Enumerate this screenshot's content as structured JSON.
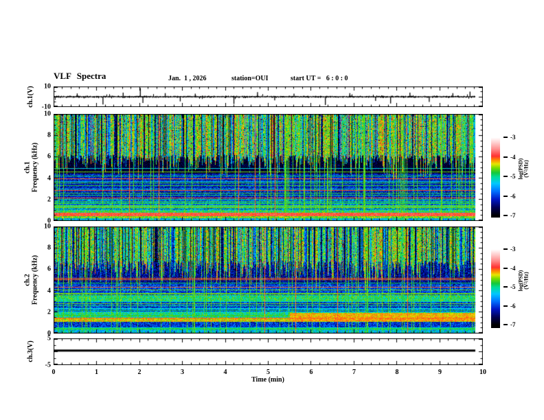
{
  "figure": {
    "background": "#ffffff"
  },
  "header": {
    "title": "VLF Spectra",
    "date_label": "Jan.  1 , 2026",
    "station_label": "station=OUI",
    "start_ut_label": "start UT =   6 : 0 : 0"
  },
  "time_axis": {
    "label": "Time (min)",
    "min": 0,
    "max": 10,
    "major_ticks": [
      0,
      1,
      2,
      3,
      4,
      5,
      6,
      7,
      8,
      9,
      10
    ],
    "minor_interval": 0.2
  },
  "colorbar": {
    "label": "log(PSD)(V²/Hz)",
    "ticks": [
      -3,
      -4,
      -5,
      -6,
      -7
    ],
    "value_range": [
      -7,
      -3
    ],
    "palette_stops": [
      [
        -7,
        "#000000"
      ],
      [
        -6.6,
        "#000050"
      ],
      [
        -6.15,
        "#0018c8"
      ],
      [
        -5.75,
        "#0070ff"
      ],
      [
        -5.35,
        "#00c8ff"
      ],
      [
        -5,
        "#00dc96"
      ],
      [
        -4.8,
        "#14c83c"
      ],
      [
        -4.55,
        "#78dc00"
      ],
      [
        -4.35,
        "#e6e600"
      ],
      [
        -4.15,
        "#ff8c00"
      ],
      [
        -3.95,
        "#ff3232"
      ],
      [
        -3.6,
        "#ff8c8c"
      ],
      [
        -3.3,
        "#ffc8c8"
      ],
      [
        -3,
        "#ffffff"
      ]
    ]
  },
  "chart_data": [
    {
      "type": "line",
      "name": "ch1_waveform",
      "ylabel": "ch.1(V)",
      "ylim": [
        -10,
        10
      ],
      "ytick_labels": [
        10,
        -10
      ],
      "xlim": [
        0,
        10
      ],
      "x_data_end": 9.83,
      "baseline": 0,
      "noise_amplitude": 0.9,
      "seed": 3,
      "spikes": [
        {
          "x": 0.55,
          "v": 3.2
        },
        {
          "x": 1.15,
          "v": -7.5
        },
        {
          "x": 1.62,
          "v": 4
        },
        {
          "x": 2.02,
          "v": 8.5
        },
        {
          "x": 2.08,
          "v": -6
        },
        {
          "x": 2.6,
          "v": 3.5
        },
        {
          "x": 2.95,
          "v": -4.5
        },
        {
          "x": 3.3,
          "v": 3
        },
        {
          "x": 4.2,
          "v": -7
        },
        {
          "x": 4.75,
          "v": 4.5
        },
        {
          "x": 5.15,
          "v": -3.5
        },
        {
          "x": 5.6,
          "v": 3
        },
        {
          "x": 6.33,
          "v": -8
        },
        {
          "x": 6.9,
          "v": 3.5
        },
        {
          "x": 7.5,
          "v": -4
        },
        {
          "x": 7.85,
          "v": -6.5
        },
        {
          "x": 8.3,
          "v": 4
        },
        {
          "x": 8.75,
          "v": -5
        },
        {
          "x": 9.3,
          "v": 3.5
        },
        {
          "x": 9.7,
          "v": 5
        }
      ],
      "description": "Noisy channel-1 voltage trace centered near 0 V with sporadic impulsive spikes up to ±9 V"
    },
    {
      "type": "heatmap",
      "name": "ch1_spectrogram",
      "ylabel": "ch.1\nFrequency (kHz)",
      "ylim": [
        0,
        10
      ],
      "yticks": [
        10,
        8,
        6,
        4,
        2,
        0
      ],
      "xlim": [
        0,
        10
      ],
      "x_data_end": 9.83,
      "value_range": [
        -7,
        -3
      ],
      "seed": 7,
      "bands": [
        {
          "f": [
            6.2,
            10
          ],
          "base": -4.55,
          "speckle": 0.5
        },
        {
          "f": [
            4.4,
            6.2
          ],
          "base": -6.75,
          "speckle": 0.3
        },
        {
          "f": [
            2,
            4.4
          ],
          "base": -6.15,
          "speckle": 0.45
        },
        {
          "f": [
            1,
            2
          ],
          "base": -5.8,
          "speckle": 0.5
        },
        {
          "f": [
            0.75,
            1
          ],
          "base": -5,
          "speckle": 0.6
        },
        {
          "f": [
            0.45,
            0.75
          ],
          "base": -3.9,
          "speckle": 0.25
        },
        {
          "f": [
            0.25,
            0.45
          ],
          "base": -4.6,
          "speckle": 0.4
        },
        {
          "f": [
            0,
            0.25
          ],
          "base": -5.4,
          "speckle": 0.5
        }
      ],
      "streak": {
        "f0": 6.2,
        "max_depth": 2.6
      },
      "vertical_lines": {
        "count": 70,
        "value": -4.7,
        "red_count": 5,
        "red_value": -4.05
      },
      "horizontal_lines": {
        "count": 30,
        "f_range": [
          0.5,
          5
        ],
        "values": [
          -4.9,
          -4.6,
          -4.05,
          -5.2,
          -4.75
        ]
      },
      "patches": [],
      "description": "Strong green emission above ~6 kHz with vertical sferic streaks, dark band 4.5-6 kHz, blue speckle below, intense red band near 0.45-0.75 kHz"
    },
    {
      "type": "heatmap",
      "name": "ch2_spectrogram",
      "ylabel": "ch.2\nFrequency (kHz)",
      "ylim": [
        0,
        10
      ],
      "yticks": [
        10,
        8,
        6,
        4,
        2,
        0
      ],
      "xlim": [
        0,
        10
      ],
      "x_data_end": 9.83,
      "value_range": [
        -7,
        -3
      ],
      "seed": 99,
      "bands": [
        {
          "f": [
            6.8,
            10
          ],
          "base": -4.65,
          "speckle": 0.5
        },
        {
          "f": [
            4.6,
            6.8
          ],
          "base": -6.35,
          "speckle": 0.45
        },
        {
          "f": [
            3.6,
            4.6
          ],
          "base": -5.95,
          "speckle": 0.5
        },
        {
          "f": [
            3,
            3.6
          ],
          "base": -4.9,
          "speckle": 0.45
        },
        {
          "f": [
            2,
            3
          ],
          "base": -6,
          "speckle": 0.5
        },
        {
          "f": [
            1.4,
            2
          ],
          "base": -5,
          "speckle": 0.5
        },
        {
          "f": [
            1.05,
            1.4
          ],
          "base": -4.35,
          "speckle": 0.35
        },
        {
          "f": [
            0.4,
            1.05
          ],
          "base": -6.05,
          "speckle": 0.5
        },
        {
          "f": [
            0,
            0.4
          ],
          "base": -5.3,
          "speckle": 0.55
        }
      ],
      "streak": {
        "f0": 6.8,
        "max_depth": 3.2
      },
      "vertical_lines": {
        "count": 60,
        "value": -4.7,
        "red_count": 4,
        "red_value": -4.05
      },
      "horizontal_lines": {
        "count": 28,
        "f_range": [
          0.4,
          5.2
        ],
        "values": [
          -4.9,
          -4.6,
          -4.05,
          -5.2,
          -4.75
        ]
      },
      "patches": [
        {
          "x": [
            5.5,
            9.83
          ],
          "f": [
            1.1,
            1.9
          ],
          "base": -4.25
        }
      ],
      "description": "Green emission above ~7 kHz, green band near 3-3.6 kHz, orange/red enhancement 1-1.9 kHz strongest in right half"
    },
    {
      "type": "line",
      "name": "ch3_waveform",
      "ylabel": "ch.3(V)",
      "ylim": [
        -5,
        5
      ],
      "ytick_labels": [
        5,
        -5
      ],
      "xlim": [
        0,
        10
      ],
      "x_data_end": 9.83,
      "flat_value": 0.3,
      "seed": 5,
      "description": "Flat channel-3 trace at ≈0.3 V across the full record"
    }
  ]
}
